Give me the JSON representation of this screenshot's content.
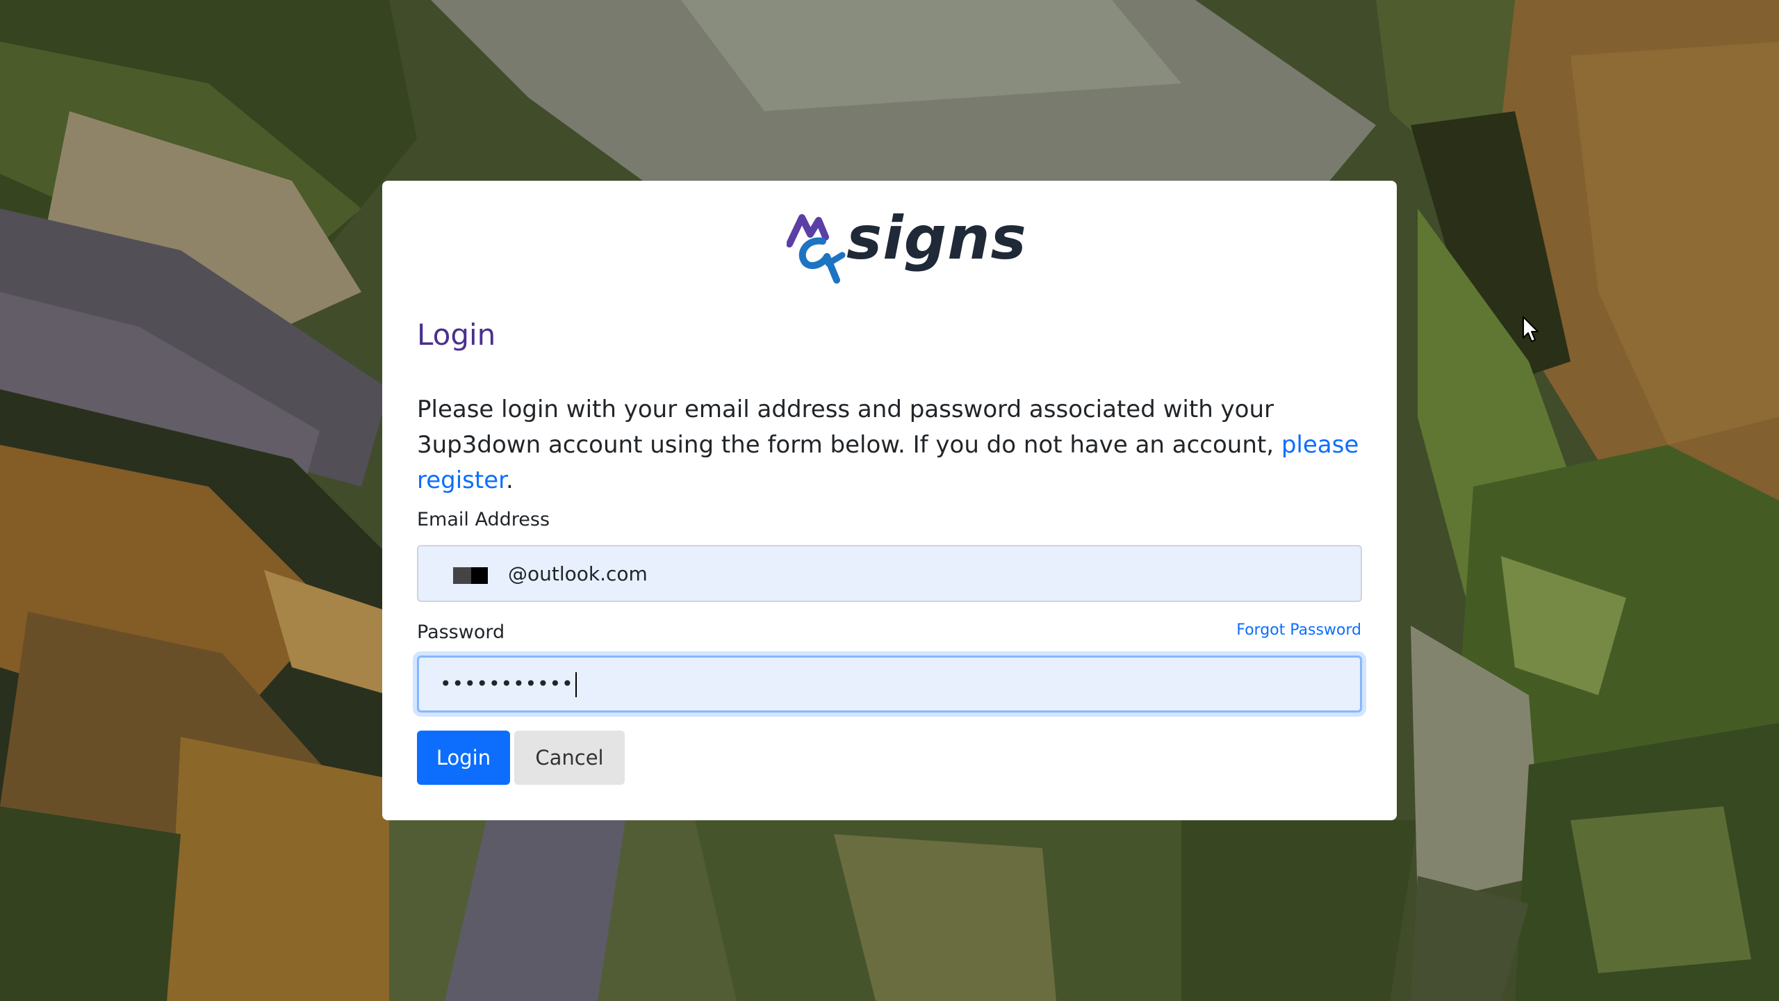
{
  "brand": {
    "name": "signs",
    "colors": {
      "purple": "#5b3fa6",
      "blue": "#1d74c2",
      "dark": "#1f2937"
    }
  },
  "login": {
    "title": "Login",
    "intro_text": "Please login with your email address and password associated with your 3up3down account using the form below. If you do not have an account, ",
    "register_link": "please register",
    "intro_end": ".",
    "email_label": "Email Address",
    "email_value": "@outlook.com",
    "password_label": "Password",
    "forgot_link": "Forgot Password",
    "password_value": "•••••••••••",
    "login_button": "Login",
    "cancel_button": "Cancel"
  },
  "colors": {
    "title": "#4b2f8f",
    "link": "#0d6efd",
    "primary_button": "#0d6efd",
    "secondary_button": "#e4e4e4",
    "input_bg": "#e8f0fe"
  }
}
